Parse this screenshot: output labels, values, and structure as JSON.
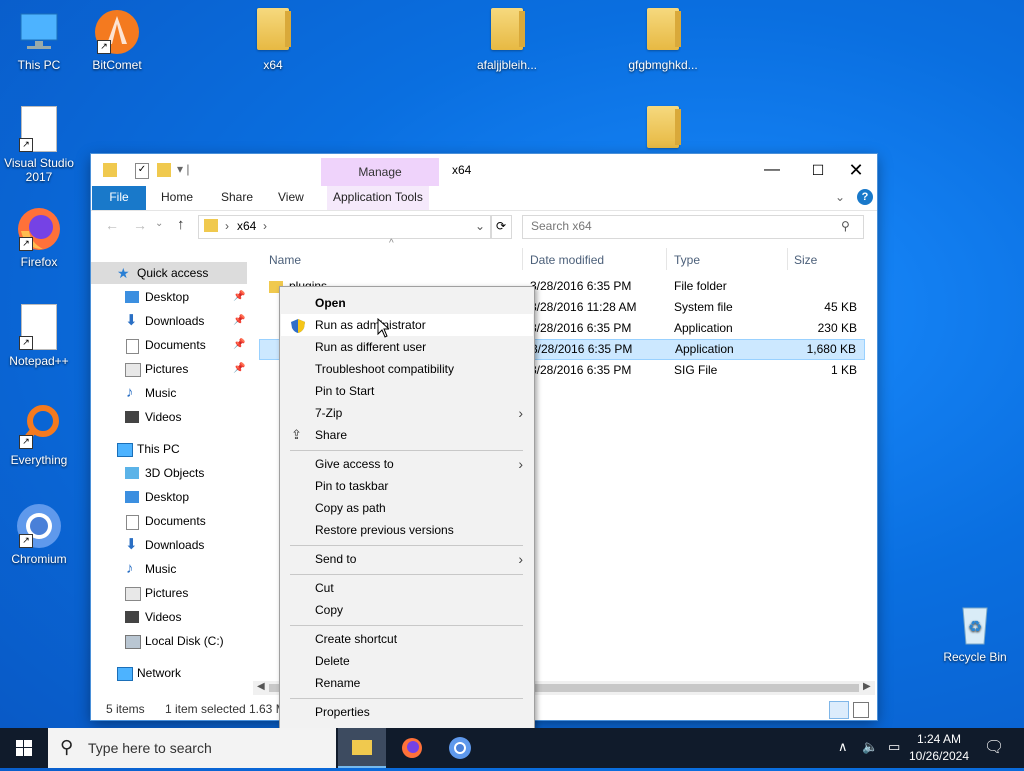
{
  "desktop": {
    "icons": [
      {
        "label": "This PC"
      },
      {
        "label": "BitComet"
      },
      {
        "label": "x64"
      },
      {
        "label": "afaljjbleih..."
      },
      {
        "label": "gfgbmghkd..."
      },
      {
        "label": "Visual Studio 2017"
      },
      {
        "label": "Firefox"
      },
      {
        "label": "Notepad++"
      },
      {
        "label": "Everything"
      },
      {
        "label": "Chromium"
      },
      {
        "label": "Recycle Bin"
      }
    ]
  },
  "window": {
    "title": "x64",
    "manage_label": "Manage",
    "tabs": [
      "File",
      "Home",
      "Share",
      "View",
      "Application Tools"
    ],
    "path": "x64",
    "search_placeholder": "Search x64",
    "columns": [
      "Name",
      "Date modified",
      "Type",
      "Size"
    ],
    "files": [
      {
        "name": "plugins",
        "date": "3/28/2016 6:35 PM",
        "type": "File folder",
        "size": ""
      },
      {
        "name": "",
        "date": "3/28/2016 11:28 AM",
        "type": "System file",
        "size": "45 KB"
      },
      {
        "name": "",
        "date": "3/28/2016 6:35 PM",
        "type": "Application",
        "size": "230 KB"
      },
      {
        "name": "",
        "date": "3/28/2016 6:35 PM",
        "type": "Application",
        "size": "1,680 KB"
      },
      {
        "name": "",
        "date": "3/28/2016 6:35 PM",
        "type": "SIG File",
        "size": "1 KB"
      }
    ],
    "nav": {
      "quick_access": "Quick access",
      "quick_items": [
        "Desktop",
        "Downloads",
        "Documents",
        "Pictures",
        "Music",
        "Videos"
      ],
      "this_pc": "This PC",
      "pc_items": [
        "3D Objects",
        "Desktop",
        "Documents",
        "Downloads",
        "Music",
        "Pictures",
        "Videos",
        "Local Disk (C:)"
      ],
      "network": "Network"
    },
    "status": {
      "items": "5 items",
      "selected": "1 item selected",
      "size": "1.63 M"
    }
  },
  "context_menu": {
    "items": [
      {
        "label": "Open",
        "bold": true
      },
      {
        "label": "Run as administrator"
      },
      {
        "label": "Run as different user"
      },
      {
        "label": "Troubleshoot compatibility"
      },
      {
        "label": "Pin to Start"
      },
      {
        "label": "7-Zip"
      },
      {
        "label": "Share"
      },
      {
        "label": "Give access to"
      },
      {
        "label": "Pin to taskbar"
      },
      {
        "label": "Copy as path"
      },
      {
        "label": "Restore previous versions"
      },
      {
        "label": "Send to"
      },
      {
        "label": "Cut"
      },
      {
        "label": "Copy"
      },
      {
        "label": "Create shortcut"
      },
      {
        "label": "Delete"
      },
      {
        "label": "Rename"
      },
      {
        "label": "Properties"
      }
    ]
  },
  "taskbar": {
    "search_placeholder": "Type here to search",
    "time": "1:24 AM",
    "date": "10/26/2024"
  },
  "colors": {
    "accent": "#1979ca",
    "manage_bg": "#efd3fb",
    "selection": "#cce8ff",
    "taskbar": "#101b2b"
  }
}
